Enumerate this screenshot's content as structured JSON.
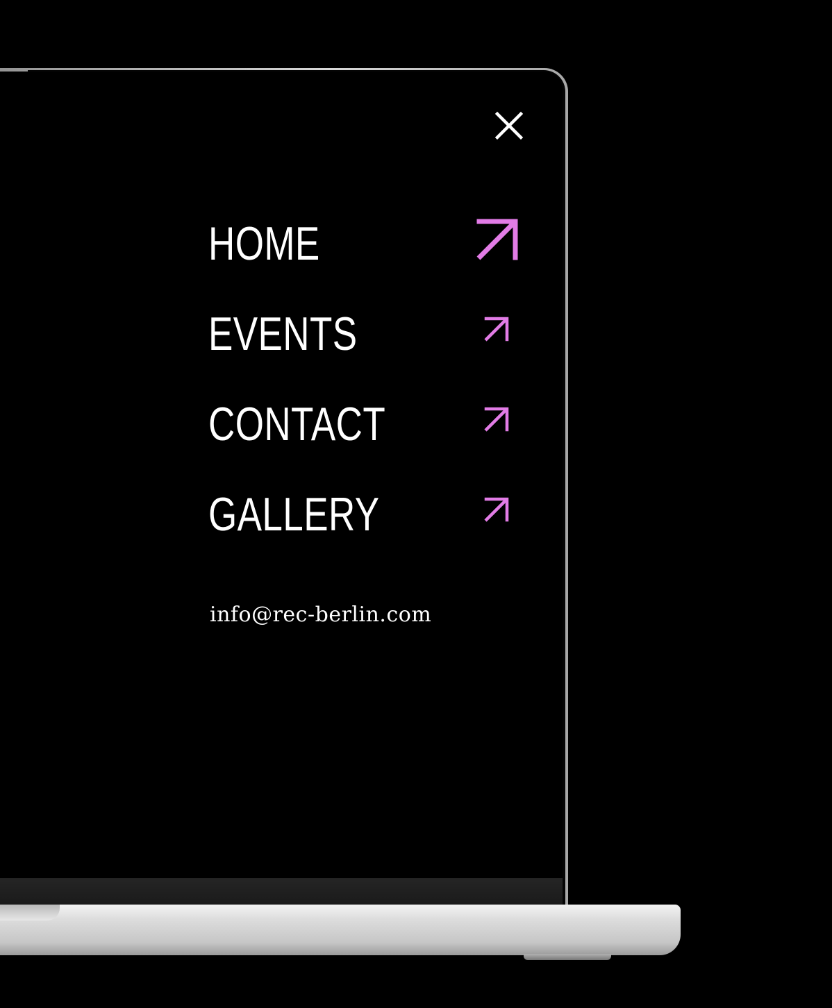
{
  "menu": {
    "close_icon": "close-icon",
    "items": [
      {
        "label": "HOME",
        "icon": "arrow-up-right-icon"
      },
      {
        "label": "EVENTS",
        "icon": "arrow-up-right-icon"
      },
      {
        "label": "CONTACT",
        "icon": "arrow-up-right-icon"
      },
      {
        "label": "GALLERY",
        "icon": "arrow-up-right-icon"
      }
    ],
    "email": "info@rec-berlin.com"
  },
  "colors": {
    "background": "#000000",
    "text": "#ffffff",
    "accent": "#e27ce6"
  }
}
